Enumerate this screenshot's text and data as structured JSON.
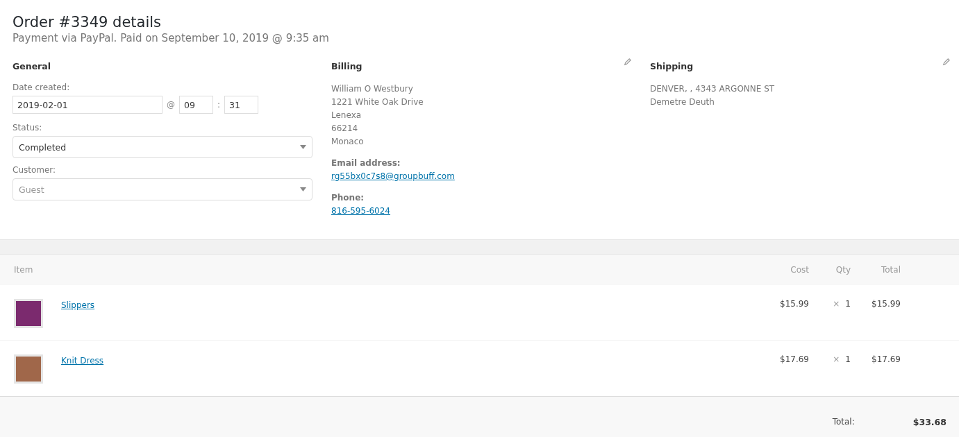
{
  "header": {
    "title": "Order #3349 details",
    "subtitle": "Payment via PayPal. Paid on September 10, 2019 @ 9:35 am"
  },
  "general": {
    "heading": "General",
    "date_label": "Date created:",
    "date": "2019-02-01",
    "at": "@",
    "hour": "09",
    "colon": ":",
    "minute": "31",
    "status_label": "Status:",
    "status": "Completed",
    "customer_label": "Customer:",
    "customer_placeholder": "Guest"
  },
  "billing": {
    "heading": "Billing",
    "address": [
      "William O Westbury",
      "1221 White Oak Drive",
      "Lenexa",
      "66214",
      "Monaco"
    ],
    "email_label": "Email address:",
    "email": "rg55bx0c7s8@groupbuff.com",
    "phone_label": "Phone:",
    "phone": "816-595-6024"
  },
  "shipping": {
    "heading": "Shipping",
    "address": [
      "DENVER, , 4343 ARGONNE ST",
      "Demetre Deuth"
    ]
  },
  "items": {
    "columns": [
      "Item",
      "Cost",
      "Qty",
      "Total"
    ],
    "rows": [
      {
        "name": "Slippers",
        "cost": "$15.99",
        "times": "×",
        "qty": "1",
        "total": "$15.99"
      },
      {
        "name": "Knit Dress",
        "cost": "$17.69",
        "times": "×",
        "qty": "1",
        "total": "$17.69"
      }
    ],
    "total_label": "Total:",
    "total": "$33.68"
  }
}
